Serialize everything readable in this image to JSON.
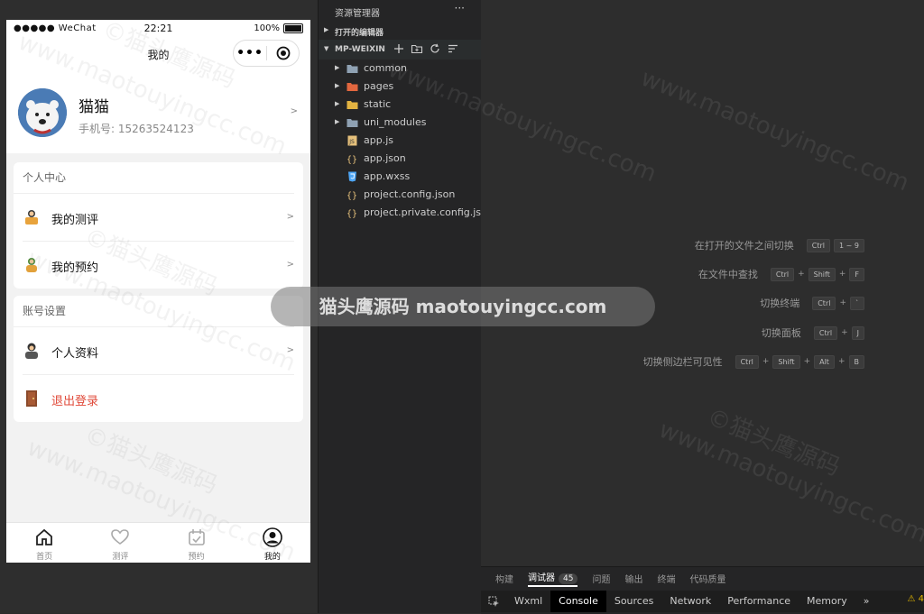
{
  "phone": {
    "status": {
      "signal": "●●●●● WeChat",
      "time": "22:21",
      "battery": "100%"
    },
    "nav_title": "我的",
    "capsule_more": "•••",
    "profile": {
      "name": "猫猫",
      "phone": "手机号: 15263524123",
      "arrow": ">"
    },
    "center": {
      "title": "个人中心",
      "items": [
        {
          "label": "我的测评",
          "icon": "assessment-icon",
          "arrow": ">"
        },
        {
          "label": "我的预约",
          "icon": "appointment-icon",
          "arrow": ">"
        }
      ]
    },
    "account": {
      "title": "账号设置",
      "items": [
        {
          "label": "个人资料",
          "icon": "profile-icon",
          "arrow": ">"
        },
        {
          "label": "退出登录",
          "icon": "logout-door-icon",
          "color": "#e04a3a"
        }
      ]
    },
    "tabs": [
      {
        "label": "首页",
        "icon": "home-icon"
      },
      {
        "label": "测评",
        "icon": "heart-icon"
      },
      {
        "label": "预约",
        "icon": "calendar-icon"
      },
      {
        "label": "我的",
        "icon": "user-icon",
        "active": true
      }
    ]
  },
  "explorer": {
    "title": "资源管理器",
    "more": "···",
    "open_editors": "打开的编辑器",
    "project": "MP-WEIXIN",
    "tree": [
      {
        "name": "common",
        "type": "folder",
        "color": "#8fa1b3"
      },
      {
        "name": "pages",
        "type": "folder",
        "color": "#e2673f"
      },
      {
        "name": "static",
        "type": "folder",
        "color": "#e3b341"
      },
      {
        "name": "uni_modules",
        "type": "folder",
        "color": "#8fa1b3"
      },
      {
        "name": "app.js",
        "type": "js",
        "color": "#e5c07b"
      },
      {
        "name": "app.json",
        "type": "json",
        "color": "#e5c07b"
      },
      {
        "name": "app.wxss",
        "type": "css",
        "color": "#4ea6f5"
      },
      {
        "name": "project.config.json",
        "type": "json",
        "color": "#e5c07b"
      },
      {
        "name": "project.private.config.js...",
        "type": "json",
        "color": "#e5c07b"
      }
    ]
  },
  "shortcuts": [
    {
      "label": "在打开的文件之间切换",
      "keys": [
        "Ctrl",
        "1 ~ 9"
      ]
    },
    {
      "label": "在文件中查找",
      "keys": [
        "Ctrl",
        "Shift",
        "F"
      ]
    },
    {
      "label": "切换终端",
      "keys": [
        "Ctrl",
        "`"
      ]
    },
    {
      "label": "切换面板",
      "keys": [
        "Ctrl",
        "J"
      ]
    },
    {
      "label": "切换侧边栏可见性",
      "keys": [
        "Ctrl",
        "Shift",
        "Alt",
        "B"
      ]
    }
  ],
  "panel": {
    "tabs": [
      "构建",
      "调试器",
      "问题",
      "输出",
      "终端",
      "代码质量"
    ],
    "active_tab": "调试器",
    "badge": "45",
    "devtools": [
      "Wxml",
      "Console",
      "Sources",
      "Network",
      "Performance",
      "Memory",
      "»"
    ],
    "active_devtool": "Console",
    "warning": "⚠ 4"
  },
  "watermark": {
    "text1": "www.maotouyingcc.com",
    "text2": "©猫头鹰源码",
    "banner": "猫头鹰源码 maotouyingcc.com"
  }
}
